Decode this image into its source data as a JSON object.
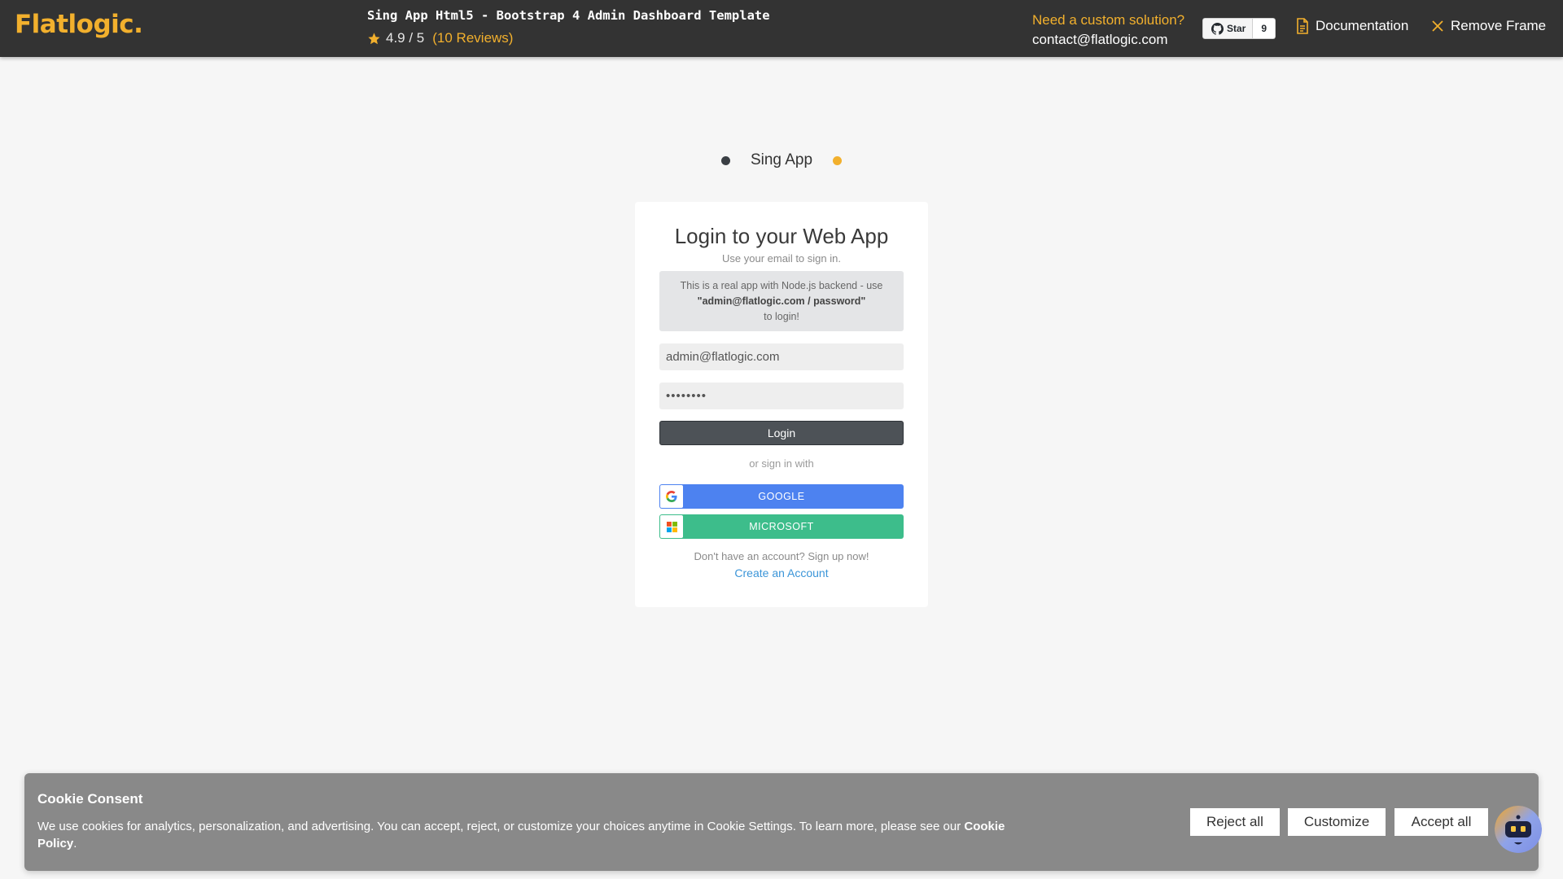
{
  "topbar": {
    "logo": "Flatlogic.",
    "product_title": "Sing App Html5 - Bootstrap 4 Admin Dashboard Template",
    "rating": "4.9 / 5",
    "reviews": "(10 Reviews)",
    "custom_question": "Need a custom solution?",
    "contact_email": "contact@flatlogic.com",
    "github_star_label": "Star",
    "github_star_count": "9",
    "documentation_label": "Documentation",
    "remove_frame_label": "Remove Frame"
  },
  "brand": {
    "name": "Sing App"
  },
  "login": {
    "title": "Login to your Web App",
    "subtitle": "Use your email to sign in.",
    "notice_line1": "This is a real app with Node.js backend - use",
    "notice_credentials": "\"admin@flatlogic.com / password\"",
    "notice_line3": "to login!",
    "email_value": "admin@flatlogic.com",
    "password_value": "********",
    "login_button": "Login",
    "or_text": "or sign in with",
    "google_button": "GOOGLE",
    "microsoft_button": "MICROSOFT",
    "signup_question": "Don't have an account? Sign up now!",
    "create_account_link": "Create an Account"
  },
  "cookie": {
    "title": "Cookie Consent",
    "text": "We use cookies for analytics, personalization, and advertising. You can accept, reject, or customize your choices anytime in Cookie Settings. To learn more, please see our ",
    "policy_link": "Cookie Policy",
    "text_end": ".",
    "reject_label": "Reject all",
    "customize_label": "Customize",
    "accept_label": "Accept all"
  },
  "colors": {
    "topbar_bg": "#333333",
    "accent": "#f2b02d",
    "google_blue": "#4d82f0",
    "microsoft_green": "#3dbd8b",
    "link_blue": "#3b95d8"
  },
  "icons": [
    "star-icon",
    "github-icon",
    "document-icon",
    "close-icon",
    "google-icon",
    "microsoft-icon",
    "chatbot-icon"
  ]
}
